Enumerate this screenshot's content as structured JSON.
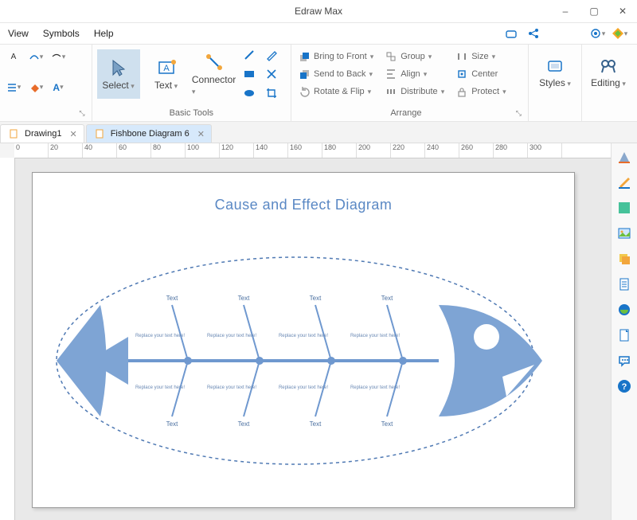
{
  "app": {
    "title": "Edraw Max"
  },
  "window_controls": {
    "min": "–",
    "max": "▢",
    "close": "✕"
  },
  "menu": {
    "view": "View",
    "symbols": "Symbols",
    "help": "Help"
  },
  "topright_icons": {
    "cloud": "cloud-link-icon",
    "share": "share-icon",
    "gear": "gear-icon",
    "logo": "edraw-logo-icon"
  },
  "ribbon": {
    "group_font": {
      "label": ""
    },
    "group_basic_tools": {
      "label": "Basic Tools",
      "select": "Select",
      "text": "Text",
      "connector": "Connector"
    },
    "group_arrange": {
      "label": "Arrange",
      "bring_front": "Bring to Front",
      "send_back": "Send to Back",
      "rotate_flip": "Rotate & Flip",
      "group": "Group",
      "align": "Align",
      "distribute": "Distribute",
      "size": "Size",
      "center": "Center",
      "protect": "Protect"
    },
    "group_styles": {
      "label": "",
      "styles": "Styles"
    },
    "group_editing": {
      "label": "",
      "editing": "Editing"
    }
  },
  "tabs": {
    "drawing1": "Drawing1",
    "fishbone": "Fishbone Diagram 6"
  },
  "ruler_marks": [
    "0",
    "20",
    "40",
    "60",
    "80",
    "100",
    "120",
    "140",
    "160",
    "180",
    "200",
    "220",
    "240",
    "260",
    "280",
    "300"
  ],
  "diagram": {
    "title": "Cause and Effect Diagram",
    "bone_label": "Text",
    "cause_placeholder": "Replace your text here!"
  }
}
